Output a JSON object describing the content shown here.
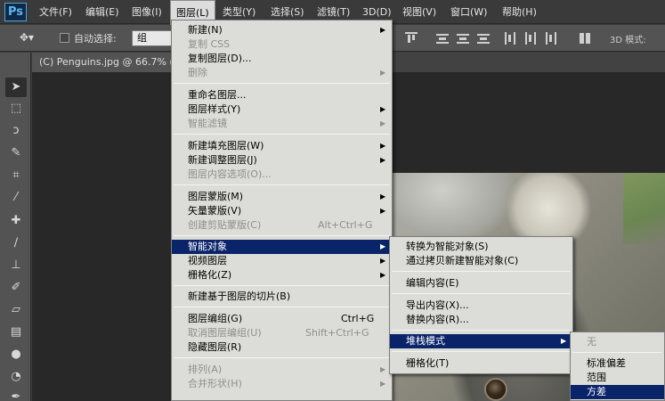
{
  "app": {
    "logo": "Ps"
  },
  "menubar": {
    "items": [
      "文件(F)",
      "编辑(E)",
      "图像(I)",
      "图层(L)",
      "类型(Y)",
      "选择(S)",
      "滤镜(T)",
      "3D(D)",
      "视图(V)",
      "窗口(W)",
      "帮助(H)"
    ],
    "active": "图层(L)"
  },
  "options_bar": {
    "autoselect_label": "自动选择:",
    "group_value": "组",
    "mode_3d_label": "3D 模式:"
  },
  "document": {
    "tab_title": "(C) Penguins.jpg @ 66.7% (R"
  },
  "layer_menu": {
    "items": [
      {
        "label": "新建(N)",
        "submenu": true
      },
      {
        "label": "复制 CSS",
        "disabled": true
      },
      {
        "label": "复制图层(D)..."
      },
      {
        "label": "删除",
        "disabled": true,
        "submenu": true
      },
      {
        "label": "重命名图层..."
      },
      {
        "label": "图层样式(Y)",
        "submenu": true
      },
      {
        "label": "智能滤镜",
        "disabled": true,
        "submenu": true
      },
      {
        "label": "新建填充图层(W)",
        "submenu": true
      },
      {
        "label": "新建调整图层(J)",
        "submenu": true
      },
      {
        "label": "图层内容选项(O)...",
        "disabled": true
      },
      {
        "label": "图层蒙版(M)",
        "submenu": true
      },
      {
        "label": "矢量蒙版(V)",
        "submenu": true
      },
      {
        "label": "创建剪贴蒙版(C)",
        "disabled": true,
        "shortcut": "Alt+Ctrl+G"
      },
      {
        "label": "智能对象",
        "submenu": true,
        "highlighted": true
      },
      {
        "label": "视频图层",
        "submenu": true
      },
      {
        "label": "栅格化(Z)",
        "submenu": true
      },
      {
        "label": "新建基于图层的切片(B)"
      },
      {
        "label": "图层编组(G)",
        "shortcut": "Ctrl+G"
      },
      {
        "label": "取消图层编组(U)",
        "disabled": true,
        "shortcut": "Shift+Ctrl+G"
      },
      {
        "label": "隐藏图层(R)"
      },
      {
        "label": "排列(A)",
        "disabled": true,
        "submenu": true
      },
      {
        "label": "合并形状(H)",
        "disabled": true,
        "submenu": true
      }
    ]
  },
  "smart_object_menu": {
    "items": [
      {
        "label": "转换为智能对象(S)"
      },
      {
        "label": "通过拷贝新建智能对象(C)"
      },
      {
        "label": "编辑内容(E)"
      },
      {
        "label": "导出内容(X)..."
      },
      {
        "label": "替换内容(R)..."
      },
      {
        "label": "堆栈模式",
        "submenu": true,
        "highlighted": true
      },
      {
        "label": "栅格化(T)"
      }
    ]
  },
  "stack_mode_menu": {
    "items": [
      {
        "label": "无",
        "disabled": true
      },
      {
        "label": "标准偏差"
      },
      {
        "label": "范围"
      },
      {
        "label": "方差",
        "highlighted": true
      }
    ]
  }
}
